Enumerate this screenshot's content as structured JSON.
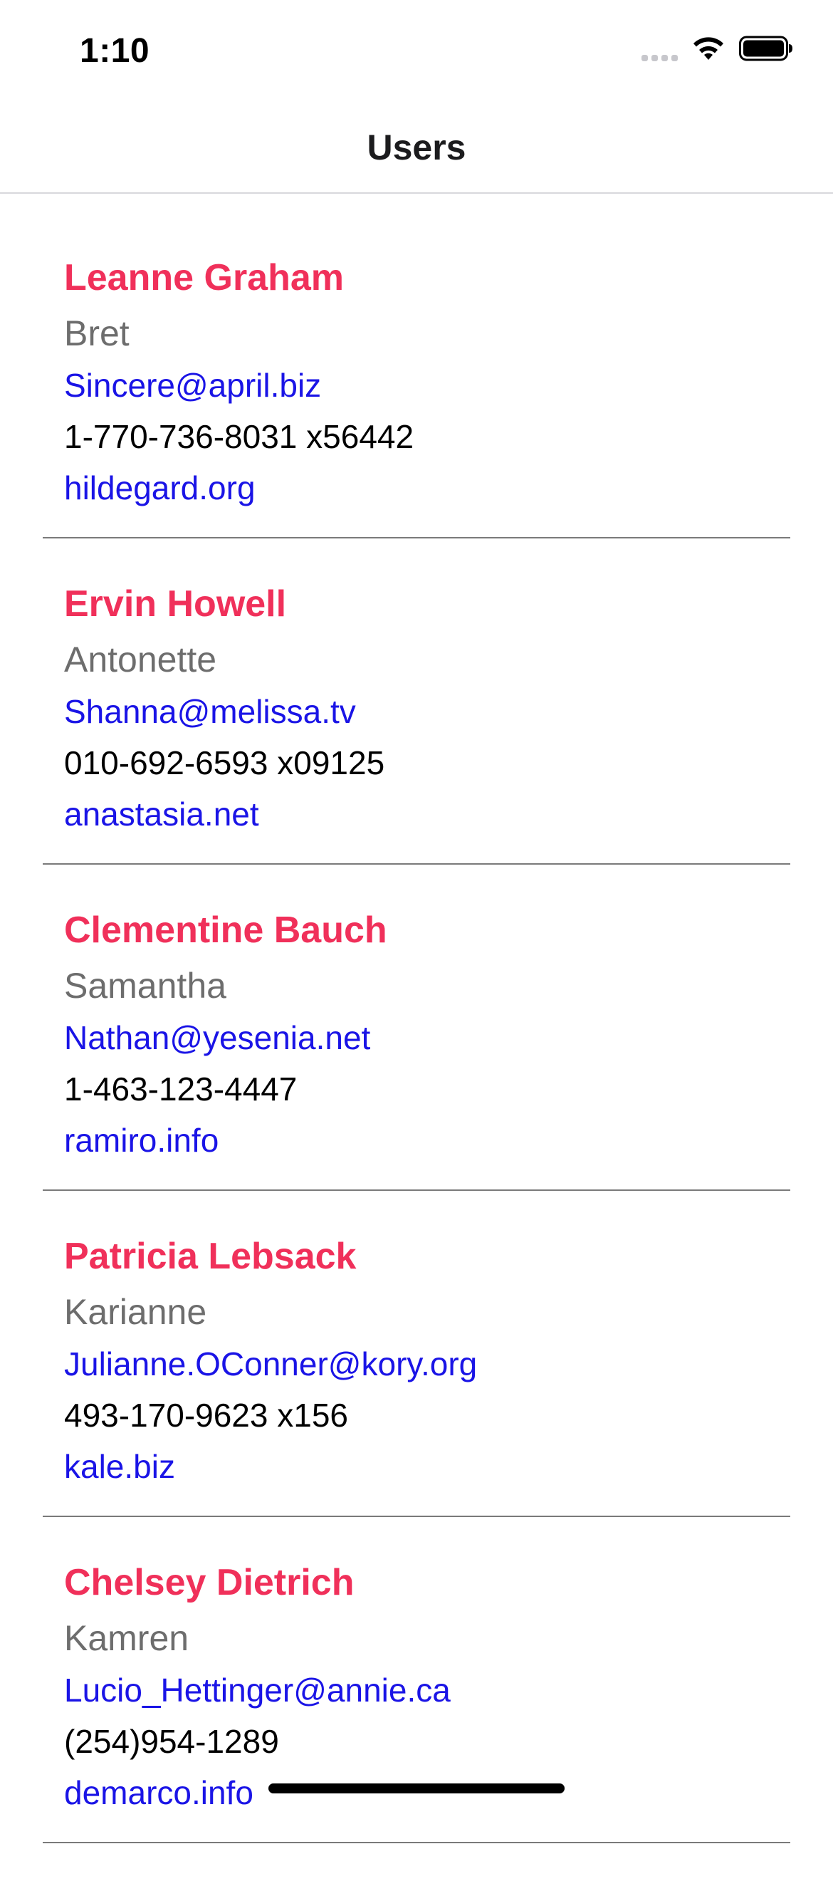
{
  "status_bar": {
    "time": "1:10",
    "icons": [
      "signal-icon",
      "wifi-icon",
      "battery-icon"
    ]
  },
  "nav": {
    "title": "Users"
  },
  "colors": {
    "name": "#f0305a",
    "link": "#1a14e6",
    "username": "#6d6d6d",
    "divider": "#7a7a7a"
  },
  "users": [
    {
      "name": "Leanne Graham",
      "username": "Bret",
      "email": "Sincere@april.biz",
      "phone": "1-770-736-8031 x56442",
      "website": "hildegard.org"
    },
    {
      "name": "Ervin Howell",
      "username": "Antonette",
      "email": "Shanna@melissa.tv",
      "phone": "010-692-6593 x09125",
      "website": "anastasia.net"
    },
    {
      "name": "Clementine Bauch",
      "username": "Samantha",
      "email": "Nathan@yesenia.net",
      "phone": "1-463-123-4447",
      "website": "ramiro.info"
    },
    {
      "name": "Patricia Lebsack",
      "username": "Karianne",
      "email": "Julianne.OConner@kory.org",
      "phone": "493-170-9623 x156",
      "website": "kale.biz"
    },
    {
      "name": "Chelsey Dietrich",
      "username": "Kamren",
      "email": "Lucio_Hettinger@annie.ca",
      "phone": "(254)954-1289",
      "website": "demarco.info"
    }
  ]
}
